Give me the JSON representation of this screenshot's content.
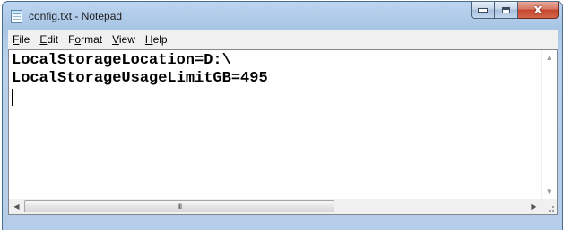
{
  "window": {
    "title": "config.txt - Notepad",
    "caption_buttons": {
      "minimize_icon": "minimize-icon",
      "maximize_icon": "maximize-icon",
      "close_glyph": "x"
    }
  },
  "menu": {
    "items": [
      {
        "accel": "F",
        "rest": "ile"
      },
      {
        "accel": "E",
        "rest": "dit"
      },
      {
        "pre": "F",
        "accel": "o",
        "rest": "rmat"
      },
      {
        "accel": "V",
        "rest": "iew"
      },
      {
        "accel": "H",
        "rest": "elp"
      }
    ]
  },
  "editor": {
    "lines": [
      "LocalStorageLocation=D:\\",
      "LocalStorageUsageLimitGB=495"
    ]
  },
  "scrollbar": {
    "thumb_grip": "III"
  },
  "colors": {
    "titlebar": "#b5cde8",
    "close_button": "#c4472c",
    "menubar": "#f0f0f0"
  }
}
